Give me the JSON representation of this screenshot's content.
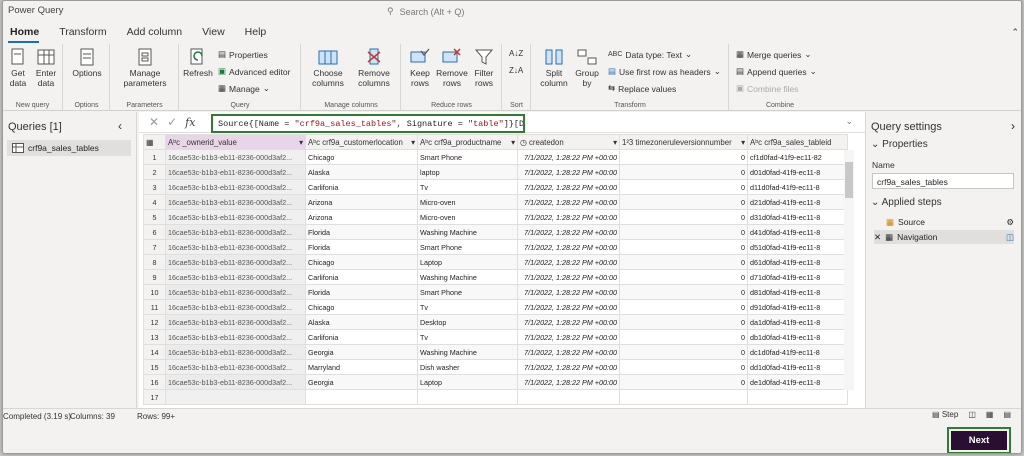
{
  "window": {
    "title": "Power Query",
    "search_placeholder": "Search (Alt + Q)"
  },
  "tabs": [
    "Home",
    "Transform",
    "Add column",
    "View",
    "Help"
  ],
  "ribbon": {
    "new_query": {
      "get_data": "Get data",
      "enter_data": "Enter data",
      "group": "New query"
    },
    "options": {
      "options": "Options",
      "group": "Options"
    },
    "parameters": {
      "manage": "Manage parameters",
      "group": "Parameters"
    },
    "query": {
      "refresh": "Refresh",
      "properties": "Properties",
      "advanced": "Advanced editor",
      "manage": "Manage",
      "group": "Query"
    },
    "manage_columns": {
      "choose": "Choose columns",
      "remove": "Remove columns",
      "group": "Manage columns"
    },
    "reduce_rows": {
      "keep": "Keep rows",
      "remove": "Remove rows",
      "filter": "Filter rows",
      "group": "Reduce rows"
    },
    "sort": {
      "group": "Sort"
    },
    "transform": {
      "split": "Split column",
      "groupby": "Group by",
      "datatype": "Data type: Text",
      "firstrow": "Use first row as headers",
      "replace": "Replace values",
      "group": "Transform"
    },
    "combine": {
      "merge": "Merge queries",
      "append": "Append queries",
      "combine_files": "Combine files",
      "group": "Combine"
    }
  },
  "queries": {
    "header": "Queries [1]",
    "items": [
      "crf9a_sales_tables"
    ]
  },
  "formula": {
    "prefix": "Source{[Name = ",
    "name": "\"crf9a_sales_tables\"",
    "mid": ", Signature = ",
    "sig": "\"table\"",
    "suffix": "]}[Data]"
  },
  "columns": [
    "_ownerid_value",
    "crf9a_customerlocation",
    "crf9a_productname",
    "createdon",
    "timezoneruleversionnumber",
    "crf9a_sales_tableid"
  ],
  "rows": [
    {
      "n": "1",
      "c1": "16cae53c-b1b3-eb11-8236-000d3af2...",
      "c2": "Chicago",
      "c3": "Smart Phone",
      "c4": "7/1/2022, 1:28:22 PM +00:00",
      "c5": "0",
      "c6": "cf1d0fad-41f9-ec11-82"
    },
    {
      "n": "2",
      "c1": "16cae53c-b1b3-eb11-8236-000d3af2...",
      "c2": "Alaska",
      "c3": "laptop",
      "c4": "7/1/2022, 1:28:22 PM +00:00",
      "c5": "0",
      "c6": "d01d0fad-41f9-ec11-8"
    },
    {
      "n": "3",
      "c1": "16cae53c-b1b3-eb11-8236-000d3af2...",
      "c2": "Carlifonia",
      "c3": "Tv",
      "c4": "7/1/2022, 1:28:22 PM +00:00",
      "c5": "0",
      "c6": "d11d0fad-41f9-ec11-8"
    },
    {
      "n": "4",
      "c1": "16cae53c-b1b3-eb11-8236-000d3af2...",
      "c2": "Arizona",
      "c3": "Micro-oven",
      "c4": "7/1/2022, 1:28:22 PM +00:00",
      "c5": "0",
      "c6": "d21d0fad-41f9-ec11-8"
    },
    {
      "n": "5",
      "c1": "16cae53c-b1b3-eb11-8236-000d3af2...",
      "c2": "Arizona",
      "c3": "Micro-oven",
      "c4": "7/1/2022, 1:28:22 PM +00:00",
      "c5": "0",
      "c6": "d31d0fad-41f9-ec11-8"
    },
    {
      "n": "6",
      "c1": "16cae53c-b1b3-eb11-8236-000d3af2...",
      "c2": "Florida",
      "c3": "Washing Machine",
      "c4": "7/1/2022, 1:28:22 PM +00:00",
      "c5": "0",
      "c6": "d41d0fad-41f9-ec11-8"
    },
    {
      "n": "7",
      "c1": "16cae53c-b1b3-eb11-8236-000d3af2...",
      "c2": "Florida",
      "c3": "Smart Phone",
      "c4": "7/1/2022, 1:28:22 PM +00:00",
      "c5": "0",
      "c6": "d51d0fad-41f9-ec11-8"
    },
    {
      "n": "8",
      "c1": "16cae53c-b1b3-eb11-8236-000d3af2...",
      "c2": "Chicago",
      "c3": "Laptop",
      "c4": "7/1/2022, 1:28:22 PM +00:00",
      "c5": "0",
      "c6": "d61d0fad-41f9-ec11-8"
    },
    {
      "n": "9",
      "c1": "16cae53c-b1b3-eb11-8236-000d3af2...",
      "c2": "Carlifonia",
      "c3": "Washing Machine",
      "c4": "7/1/2022, 1:28:22 PM +00:00",
      "c5": "0",
      "c6": "d71d0fad-41f9-ec11-8"
    },
    {
      "n": "10",
      "c1": "16cae53c-b1b3-eb11-8236-000d3af2...",
      "c2": "Florida",
      "c3": "Smart Phone",
      "c4": "7/1/2022, 1:28:22 PM +00:00",
      "c5": "0",
      "c6": "d81d0fad-41f9-ec11-8"
    },
    {
      "n": "11",
      "c1": "16cae53c-b1b3-eb11-8236-000d3af2...",
      "c2": "Chicago",
      "c3": "Tv",
      "c4": "7/1/2022, 1:28:22 PM +00:00",
      "c5": "0",
      "c6": "d91d0fad-41f9-ec11-8"
    },
    {
      "n": "12",
      "c1": "16cae53c-b1b3-eb11-8236-000d3af2...",
      "c2": "Alaska",
      "c3": "Desktop",
      "c4": "7/1/2022, 1:28:22 PM +00:00",
      "c5": "0",
      "c6": "da1d0fad-41f9-ec11-8"
    },
    {
      "n": "13",
      "c1": "16cae53c-b1b3-eb11-8236-000d3af2...",
      "c2": "Carlifonia",
      "c3": "Tv",
      "c4": "7/1/2022, 1:28:22 PM +00:00",
      "c5": "0",
      "c6": "db1d0fad-41f9-ec11-8"
    },
    {
      "n": "14",
      "c1": "16cae53c-b1b3-eb11-8236-000d3af2...",
      "c2": "Georgia",
      "c3": "Washing Machine",
      "c4": "7/1/2022, 1:28:22 PM +00:00",
      "c5": "0",
      "c6": "dc1d0fad-41f9-ec11-8"
    },
    {
      "n": "15",
      "c1": "16cae53c-b1b3-eb11-8236-000d3af2...",
      "c2": "Marryland",
      "c3": "Dish washer",
      "c4": "7/1/2022, 1:28:22 PM +00:00",
      "c5": "0",
      "c6": "dd1d0fad-41f9-ec11-8"
    },
    {
      "n": "16",
      "c1": "16cae53c-b1b3-eb11-8236-000d3af2...",
      "c2": "Georgia",
      "c3": "Laptop",
      "c4": "7/1/2022, 1:28:22 PM +00:00",
      "c5": "0",
      "c6": "de1d0fad-41f9-ec11-8"
    },
    {
      "n": "17",
      "c1": "",
      "c2": "",
      "c3": "",
      "c4": "",
      "c5": "",
      "c6": ""
    }
  ],
  "settings": {
    "header": "Query settings",
    "properties": "Properties",
    "name_label": "Name",
    "name_value": "crf9a_sales_tables",
    "applied_steps": "Applied steps",
    "steps": [
      "Source",
      "Navigation"
    ]
  },
  "status": {
    "completed": "Completed (3.19 s)",
    "columns": "Columns: 39",
    "rows": "Rows: 99+",
    "step": "Step"
  },
  "footer": {
    "next": "Next"
  },
  "colors": {
    "accent": "#2e7d32",
    "next_bg": "#2b0f33",
    "tab_underline": "#1a6fb4"
  }
}
